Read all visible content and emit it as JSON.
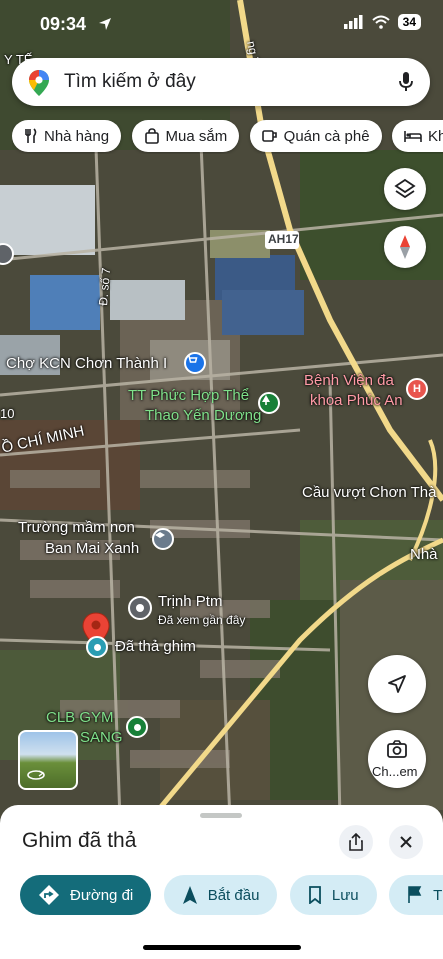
{
  "status": {
    "time": "09:34",
    "battery": "34"
  },
  "search": {
    "placeholder": "Tìm kiếm ở đây"
  },
  "chips": [
    {
      "label": "Nhà hàng",
      "icon": "fork-knife-icon"
    },
    {
      "label": "Mua sắm",
      "icon": "shopping-bag-icon"
    },
    {
      "label": "Quán cà phê",
      "icon": "coffee-cup-icon"
    },
    {
      "label": "Khá",
      "icon": "bed-icon"
    }
  ],
  "map": {
    "labels": {
      "road_ah17": "AH17",
      "road_top": "ng Tô Hiến",
      "road_d7": "Đ. số 7",
      "cho_kcn": "Chợ KCN Chơn Thành I",
      "tt_phuc_hop_1": "TT Phức Hợp Thể",
      "tt_phuc_hop_2": "Thao Yến Dương",
      "benh_vien_1": "Bệnh Viện đa",
      "benh_vien_2": "khoa Phúc An",
      "ho_chi_minh": "Ồ CHÍ MINH",
      "left_10": "10",
      "cau_vuot": "Cầu vượt Chơn Thà",
      "nha": "Nhà",
      "truong_1": "Trường mầm non",
      "truong_2": "Ban Mai Xanh",
      "trinh_ptm": "Trịnh Ptm",
      "da_xem": "Đã xem gần đây",
      "da_tha_ghim": "Đã thả ghim",
      "clb_gym_1": "CLB GYM",
      "clb_gym_2": "SANG",
      "top_left": "Y TẾ"
    },
    "street_view_label": "Ch...em"
  },
  "sheet": {
    "title": "Ghim đã thả",
    "actions": [
      {
        "label": "Đường đi",
        "icon": "directions-icon"
      },
      {
        "label": "Bắt đầu",
        "icon": "navigation-arrow-icon"
      },
      {
        "label": "Lưu",
        "icon": "bookmark-icon"
      },
      {
        "label": "Thê",
        "icon": "flag-icon"
      }
    ]
  },
  "colors": {
    "accent": "#146c7a",
    "pin": "#ea4335",
    "poi_blue": "#1a73e8",
    "poi_green": "#188038",
    "poi_red": "#e8554e"
  }
}
